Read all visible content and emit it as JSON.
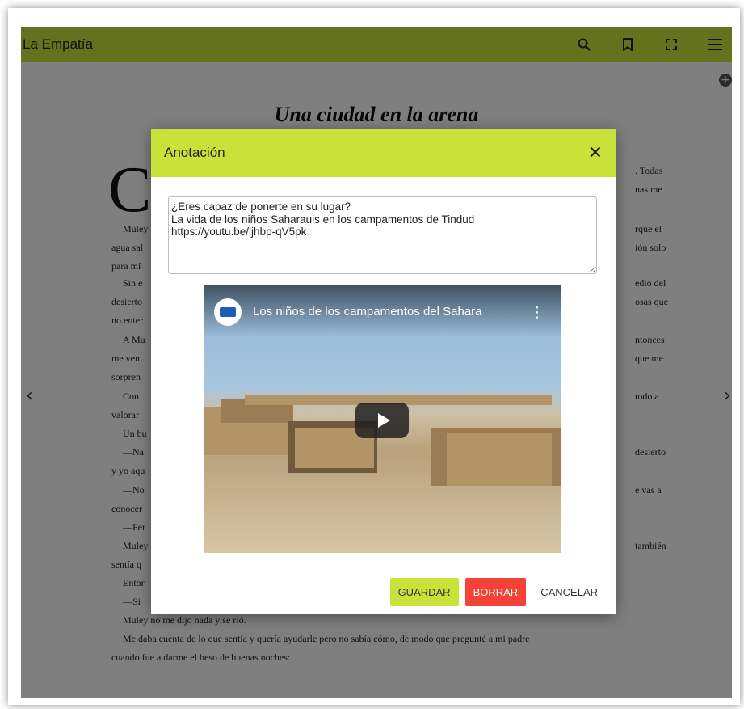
{
  "app": {
    "title": "La Empatía",
    "accent": "#c9e23a"
  },
  "toolbar": {
    "icons": [
      "search-icon",
      "bookmark-icon",
      "fullscreen-icon",
      "menu-icon"
    ]
  },
  "book": {
    "title": "Una ciudad en la arena",
    "dropcap": "C",
    "lines_right": [
      ". Todas",
      "nas me",
      "rque el",
      "ión solo",
      "edio del",
      "osas que",
      "ntonces",
      "que me",
      " todo a",
      "desierto",
      "e vas a",
      "también"
    ],
    "lines_left": [
      "Muley",
      "agua sal",
      "para mí",
      "Sin e",
      "desierto",
      "no enter",
      "A Mu",
      "me ven",
      "sorpren",
      "Con",
      "valorar",
      "Un bu",
      "—Na",
      "y yo aqu",
      "—No",
      "conocer",
      "—Per",
      "Muley",
      "sentía q",
      "Entor",
      "—Si"
    ],
    "bottom_lines": [
      "Muley no me dijo nada y se rió.",
      "Me daba cuenta de lo que sentía y quería ayudarle pero no sabía cómo, de modo que pregunté a mi padre",
      "cuando fue a darme el beso de buenas noches:"
    ]
  },
  "dialog": {
    "title": "Anotación",
    "note": "¿Eres capaz de ponerte en su lugar?\nLa vida de los niños Saharauis en los campamentos de Tindud\nhttps://youtu.be/ljhbp-qV5pk",
    "video_title": "Los niños de los campamentos del Sahara",
    "save_label": "GUARDAR",
    "delete_label": "BORRAR",
    "cancel_label": "CANCELAR",
    "save_color": "#c9e23a",
    "delete_color": "#f44336"
  }
}
